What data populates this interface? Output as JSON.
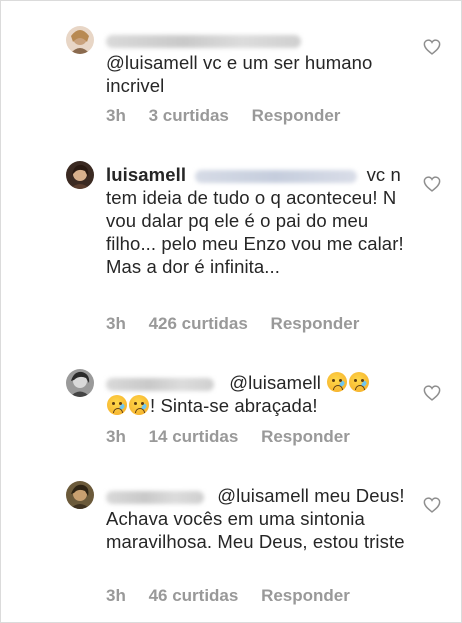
{
  "comments": [
    {
      "text": "@luisamell vc e um ser humano incrivel",
      "time": "3h",
      "likes": "3 curtidas",
      "reply": "Responder"
    },
    {
      "username": "luisamell",
      "text": "vc n tem ideia de tudo o q aconteceu! N vou dalar pq ele é o pai do meu filho... pelo meu Enzo vou me calar! Mas a dor é infinita...",
      "time": "3h",
      "likes": "426 curtidas",
      "reply": "Responder"
    },
    {
      "mention": "@luisamell",
      "text": "! Sinta-se abraçada!",
      "time": "3h",
      "likes": "14 curtidas",
      "reply": "Responder"
    },
    {
      "mention": "@luisamell",
      "text": "meu Deus! Achava vocês  em uma sintonia maravilhosa. Meu Deus, estou triste",
      "time": "3h",
      "likes": "46 curtidas",
      "reply": "Responder"
    }
  ],
  "icons": {
    "like": "heart-outline-icon",
    "emoji": "crying-face-emoji"
  },
  "colors": {
    "text": "#262626",
    "meta": "#999999",
    "border": "#dbdbdb"
  }
}
